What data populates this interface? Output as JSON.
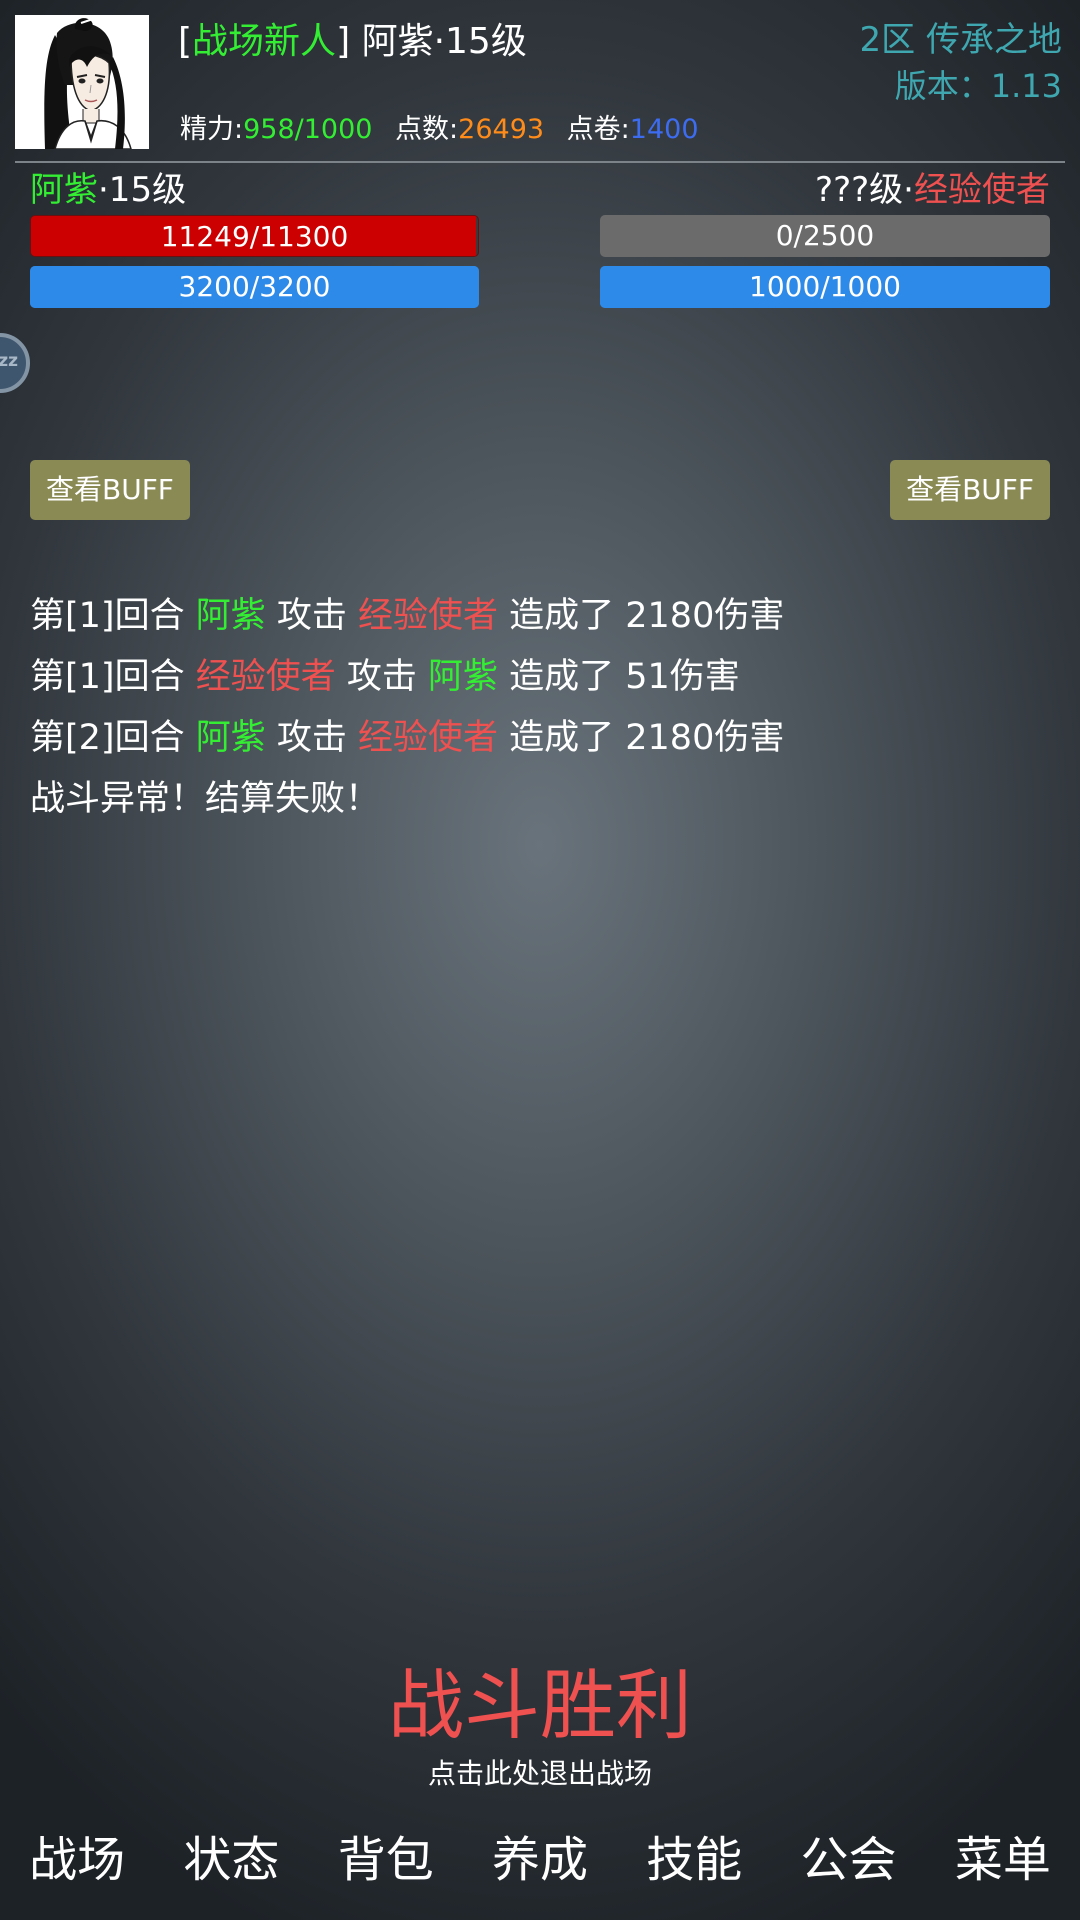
{
  "colors": {
    "green": "#33ee33",
    "red": "#ef5050",
    "orange": "#ff8c1a",
    "blue": "#3d6cf0",
    "cyan": "#3fa7b0",
    "white": "#ffffff"
  },
  "header": {
    "title_bracket_open": "[",
    "title_badge": "战场新人",
    "title_bracket_close": "]",
    "player_name": "阿紫",
    "player_level": "·15级",
    "energy_label": "精力:",
    "energy_value": "958/1000",
    "points_label": "点数:",
    "points_value": "26493",
    "vouchers_label": "点卷:",
    "vouchers_value": "1400",
    "server_name": "2区 传承之地",
    "version_label": "版本：",
    "version_value": "1.13"
  },
  "player": {
    "name": "阿紫",
    "level": "·15级",
    "hp_text": "11249/11300",
    "hp_fraction": 0.9955,
    "mp_text": "3200/3200",
    "mp_fraction": 1.0
  },
  "enemy": {
    "level": "???级·",
    "name": "经验使者",
    "hp_text": "0/2500",
    "hp_fraction": 0.0,
    "mp_text": "1000/1000",
    "mp_fraction": 1.0
  },
  "float_button": {
    "label": "zz"
  },
  "buff": {
    "player_label": "查看BUFF",
    "enemy_label": "查看BUFF"
  },
  "battle_log": [
    {
      "round": "第[1]回合 ",
      "attacker": "阿紫",
      "attacker_color": "green",
      "verb": " 攻击 ",
      "target": "经验使者",
      "target_color": "red",
      "result": " 造成了 2180伤害"
    },
    {
      "round": "第[1]回合 ",
      "attacker": "经验使者",
      "attacker_color": "red",
      "verb": " 攻击 ",
      "target": "阿紫",
      "target_color": "green",
      "result": " 造成了 51伤害"
    },
    {
      "round": "第[2]回合 ",
      "attacker": "阿紫",
      "attacker_color": "green",
      "verb": " 攻击 ",
      "target": "经验使者",
      "target_color": "red",
      "result": " 造成了 2180伤害"
    }
  ],
  "battle_message": "战斗异常！结算失败！",
  "result": {
    "title": "战斗胜利",
    "hint": "点击此处退出战场"
  },
  "nav": [
    "战场",
    "状态",
    "背包",
    "养成",
    "技能",
    "公会",
    "菜单"
  ]
}
